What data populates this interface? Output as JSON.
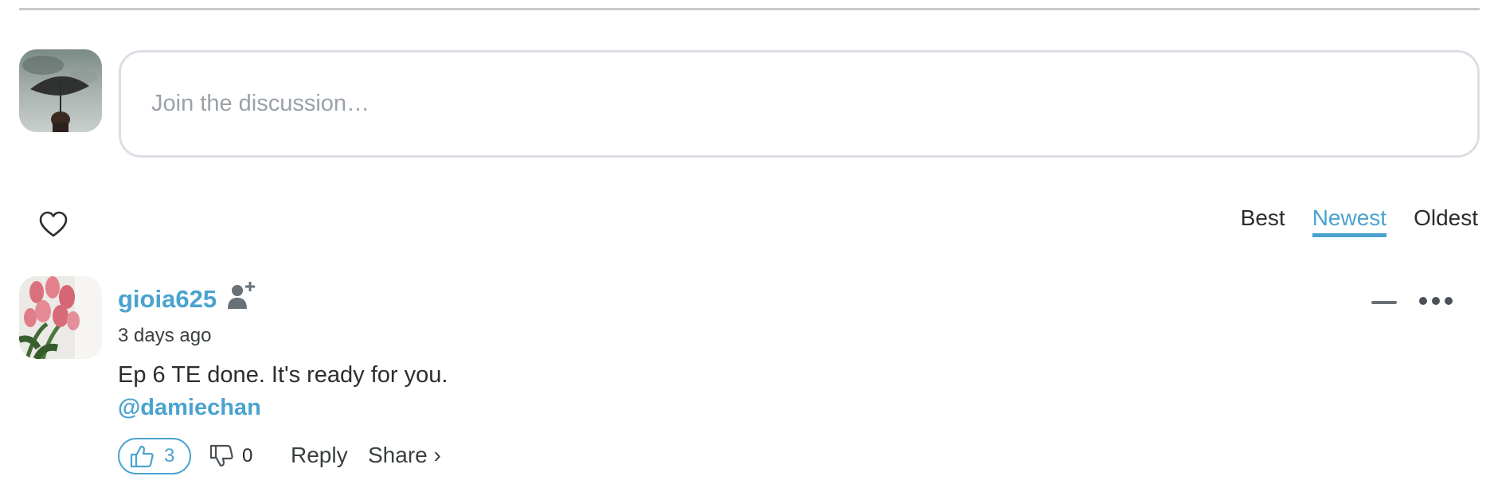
{
  "composer": {
    "placeholder": "Join the discussion…"
  },
  "sort": {
    "tabs": [
      {
        "label": "Best"
      },
      {
        "label": "Newest"
      },
      {
        "label": "Oldest"
      }
    ],
    "active": "Newest"
  },
  "comment": {
    "author": "gioia625",
    "timestamp": "3 days ago",
    "text": "Ep 6 TE done. It's ready for you.",
    "mention": "@damiechan",
    "upvotes": "3",
    "downvotes": "0",
    "reply_label": "Reply",
    "share_label": "Share ›"
  },
  "colors": {
    "accent": "#4aa3cf",
    "text": "#2a2e2e",
    "border": "#dbdfe4"
  },
  "icons": [
    "heart-icon",
    "follow-user-icon",
    "collapse-icon",
    "more-options-icon",
    "thumbs-up-icon",
    "thumbs-down-icon"
  ]
}
